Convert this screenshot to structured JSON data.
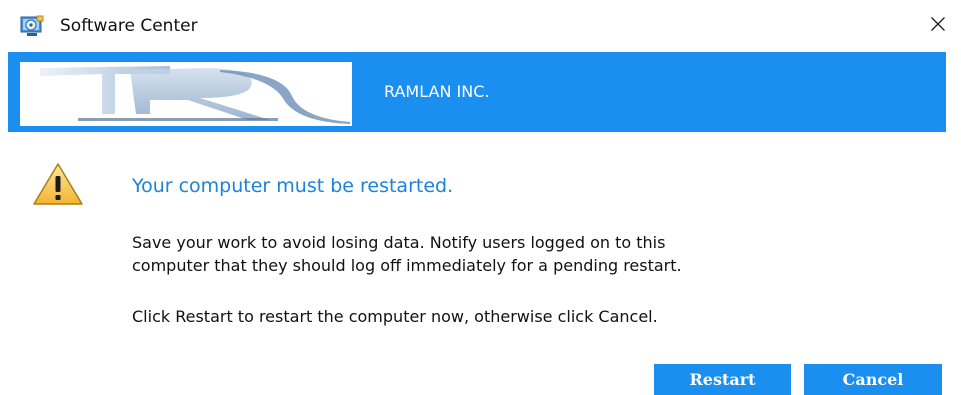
{
  "window": {
    "title": "Software Center",
    "close_glyph": "✕"
  },
  "banner": {
    "company_name": "RAMLAN INC.",
    "color": "#1b8ff0"
  },
  "dialog": {
    "icon": "warning-icon",
    "heading": "Your computer must be restarted.",
    "heading_color": "#1b83d8",
    "message_lines": [
      "Save your work to avoid losing data. Notify users logged on to this",
      "computer that they should log off immediately for a pending restart."
    ],
    "instruction": "Click Restart to restart the computer now, otherwise click Cancel."
  },
  "buttons": {
    "restart_label": "Restart",
    "cancel_label": "Cancel"
  }
}
